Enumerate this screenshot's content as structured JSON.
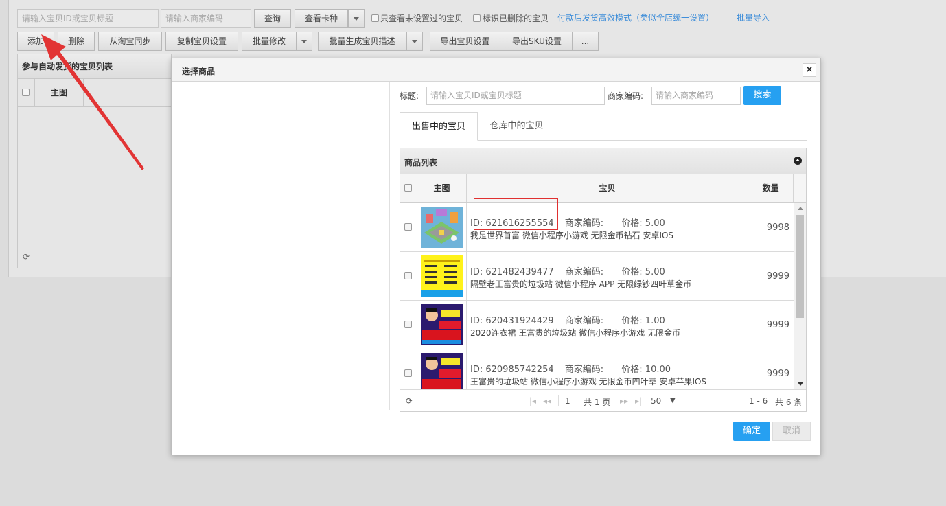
{
  "toolbar": {
    "search_placeholder": "请输入宝贝ID或宝贝标题",
    "code_placeholder": "请输入商家编码",
    "query_label": "查询",
    "view_card_label": "查看卡种",
    "only_unset_label": "只查看未设置过的宝贝",
    "mark_deleted_label": "标识已删除的宝贝",
    "mode_link": "付款后发货高效模式（类似全店统一设置）",
    "batch_import_link": "批量导入",
    "buttons": {
      "add": "添加",
      "delete": "删除",
      "sync": "从淘宝同步",
      "copy_settings": "复制宝贝设置",
      "batch_modify": "批量修改",
      "batch_generate": "批量生成宝贝描述",
      "export_settings": "导出宝贝设置",
      "export_sku": "导出SKU设置",
      "more": "..."
    }
  },
  "bg_list": {
    "title": "参与自动发货的宝贝列表",
    "col_main_image": "主图",
    "refresh_icon": "refresh-icon"
  },
  "modal": {
    "title": "选择商品",
    "close_glyph": "×",
    "search": {
      "title_label": "标题:",
      "title_placeholder": "请输入宝贝ID或宝贝标题",
      "code_label": "商家编码:",
      "code_placeholder": "请输入商家编码",
      "search_button": "搜索"
    },
    "tabs": [
      {
        "label": "出售中的宝贝",
        "active": true
      },
      {
        "label": "仓库中的宝贝",
        "active": false
      }
    ],
    "grid": {
      "title": "商品列表",
      "columns": [
        "主图",
        "宝贝",
        "数量"
      ],
      "rows": [
        {
          "id_text": "ID:  621616255554",
          "code_text": "商家编码:",
          "price_text": "价格: 5.00",
          "title": "我是世界首富 微信小程序小游戏 无限金币钻石 安卓IOS",
          "qty": "9998"
        },
        {
          "id_text": "ID:  621482439477",
          "code_text": "商家编码:",
          "price_text": "价格: 5.00",
          "title": "隔壁老王富贵的垃圾站 微信小程序 APP 无限绿钞四叶草金币",
          "qty": "9999"
        },
        {
          "id_text": "ID:  620431924429",
          "code_text": "商家编码:",
          "price_text": "价格: 1.00",
          "title": "2020连衣裙 王富贵的垃圾站 微信小程序小游戏 无限金币",
          "qty": "9999"
        },
        {
          "id_text": "ID:  620985742254",
          "code_text": "商家编码:",
          "price_text": "价格: 10.00",
          "title": "王富贵的垃圾站 微信小程序小游戏 无限金币四叶草 安卓苹果IOS",
          "qty": "9999"
        }
      ],
      "pager": {
        "page": "1",
        "total_pages": "共 1 页",
        "page_size": "50",
        "range": "1 - 6",
        "total": "共 6 条"
      }
    },
    "confirm": "确定",
    "cancel": "取消"
  },
  "colors": {
    "accent": "#26a0f1",
    "highlight": "#e03030"
  }
}
